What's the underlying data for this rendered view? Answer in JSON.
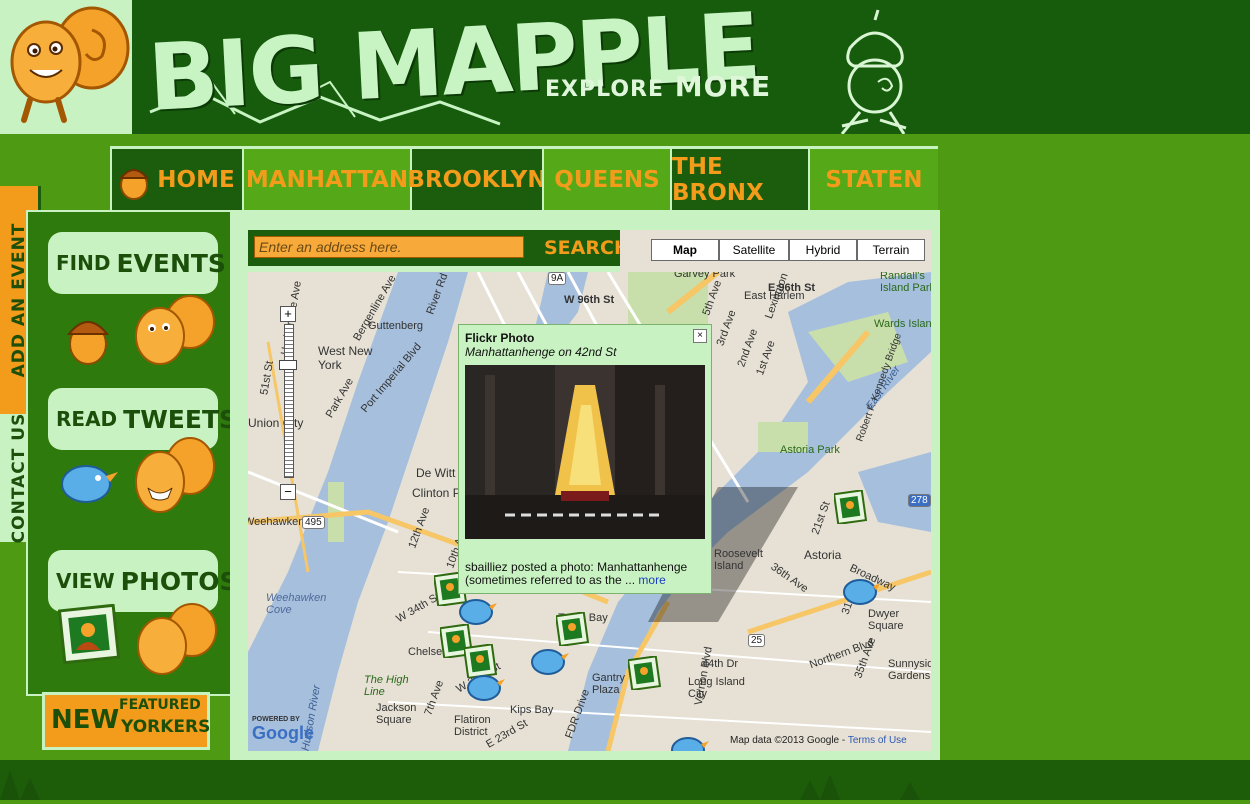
{
  "header": {
    "title": "BIG MAPPLE",
    "tagline_small": "EXPLORE",
    "tagline_big": "MORE"
  },
  "nav": {
    "tabs": [
      {
        "label": "HOME"
      },
      {
        "label": "MANHATTAN"
      },
      {
        "label": "BROOKLYN"
      },
      {
        "label": "QUEENS"
      },
      {
        "label": "THE BRONX"
      },
      {
        "label": "STATEN"
      }
    ]
  },
  "side_tabs": {
    "add_event": "ADD AN EVENT",
    "contact": "CONTACT US"
  },
  "sidebar": {
    "find_events": {
      "small": "FIND",
      "big": "EVENTS"
    },
    "read_tweets": {
      "small": "READ",
      "big": "TWEETS"
    },
    "view_photos": {
      "small": "VIEW",
      "big": "PHOTOS."
    },
    "new_yorkers": {
      "big": "NEW",
      "featured": "FEATURED",
      "rest": "YORKERS"
    }
  },
  "search": {
    "placeholder": "Enter an address here.",
    "button": "SEARCH"
  },
  "map": {
    "types": [
      "Map",
      "Satellite",
      "Hybrid",
      "Terrain"
    ],
    "active_type": "Map",
    "zoom_in": "+",
    "zoom_out": "−",
    "attribution": "Map data ©2013 Google",
    "terms": "Terms of Use",
    "powered_by": "POWERED BY",
    "google": "Google",
    "labels": [
      "Garvey Park",
      "W 96th St",
      "E 96th St",
      "East Harlem",
      "Randall's Island Park",
      "Wards Island",
      "Guttenberg",
      "West New York",
      "Union City",
      "Weehawken",
      "Astoria Park",
      "Astoria",
      "Roosevelt Island",
      "Dwyer Square",
      "Sunnyside Gardens",
      "Long Island City",
      "Weehawken Cove",
      "Chelsea",
      "The High Line",
      "Jackson Square",
      "Flatiron District",
      "Kips Bay",
      "Gantry Plaza",
      "Turtle Bay",
      "Hudson River",
      "FDR Drive",
      "East River",
      "Northern Blvd",
      "Vernon Blvd",
      "Broadway",
      "Park Ave",
      "Bergenline Ave",
      "Port Imperial Blvd",
      "Clinton Park",
      "De Witt",
      "W 34th St",
      "21st St",
      "31st St",
      "36th Ave",
      "44th Dr",
      "35th Ave",
      "12th Ave",
      "10th Ave",
      "7th Ave",
      "5th Ave",
      "2nd Ave",
      "1st Ave",
      "Lexington Ave",
      "3rd Ave",
      "Robert F. Kennedy Bridge",
      "River Rd",
      "Harborside Ave",
      "51st St",
      "W 23rd St",
      "E 23rd St",
      "9A",
      "495",
      "278",
      "25"
    ]
  },
  "info_window": {
    "title": "Flickr Photo",
    "subtitle": "Manhattanhenge on 42nd St",
    "caption": "sbailliez posted a photo: Manhattanhenge (sometimes referred to as the ...",
    "more": "more"
  },
  "colors": {
    "dark_green": "#165c0c",
    "mid_green": "#4e9a12",
    "light_green": "#c9f2c2",
    "orange": "#f39b1a",
    "water": "#a5bfdd",
    "park": "#c9dfab"
  }
}
